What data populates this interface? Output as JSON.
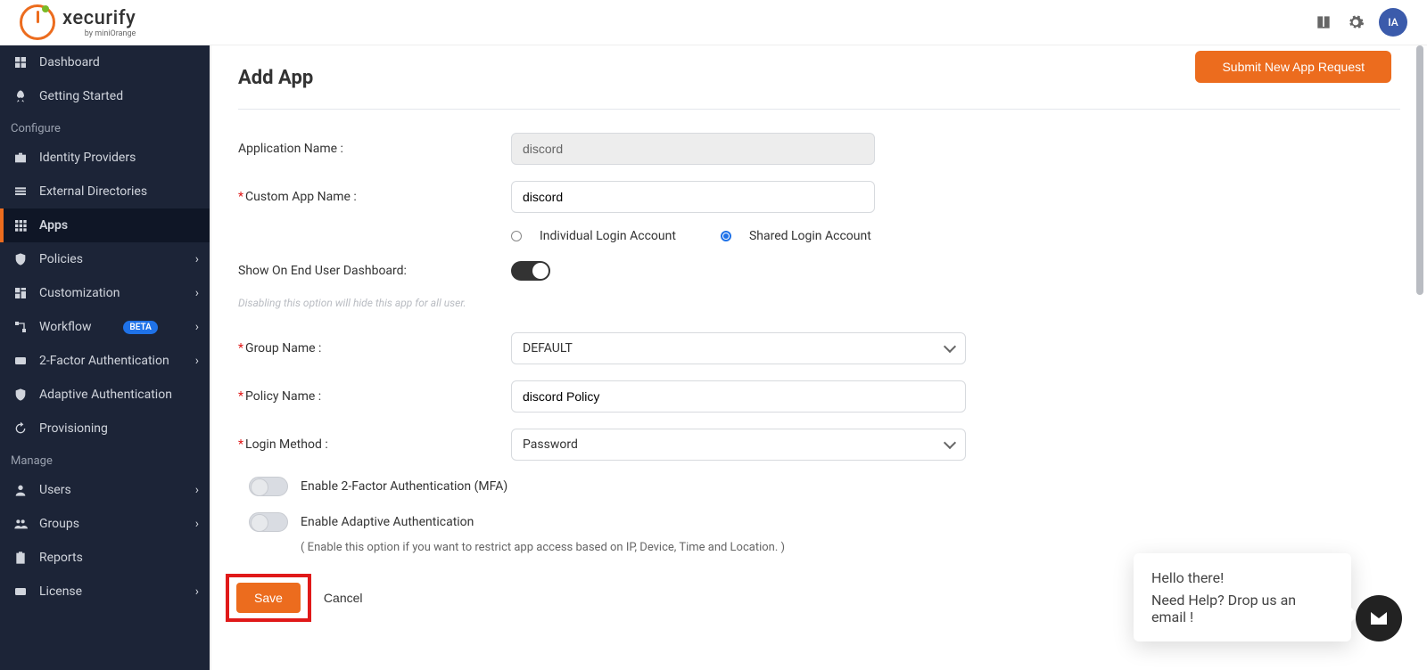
{
  "header": {
    "brand": "xecurify",
    "sub_brand": "by miniOrange",
    "avatar_initials": "IA"
  },
  "sidebar": {
    "sections": {
      "configure": "Configure",
      "manage": "Manage"
    },
    "items": {
      "dashboard": "Dashboard",
      "getting_started": "Getting Started",
      "identity_providers": "Identity Providers",
      "external_directories": "External Directories",
      "apps": "Apps",
      "policies": "Policies",
      "customization": "Customization",
      "workflow": "Workflow",
      "workflow_badge": "BETA",
      "two_factor": "2-Factor Authentication",
      "adaptive_auth": "Adaptive Authentication",
      "provisioning": "Provisioning",
      "users": "Users",
      "groups": "Groups",
      "reports": "Reports",
      "license": "License"
    }
  },
  "main": {
    "top_button": "Submit New App Request",
    "title": "Add App",
    "labels": {
      "app_name": "Application Name :",
      "custom_app_name": "Custom App Name :",
      "individual_login": "Individual Login Account",
      "shared_login": "Shared Login Account",
      "show_dashboard": "Show On End User Dashboard:",
      "disable_hint": "Disabling this option will hide this app for all user.",
      "group_name": "Group Name :",
      "policy_name": "Policy Name :",
      "login_method": "Login Method :",
      "enable_2fa": "Enable 2-Factor Authentication (MFA)",
      "enable_adaptive": "Enable Adaptive Authentication",
      "adaptive_hint": "( Enable this option if you want to restrict app access based on IP, Device, Time and Location. )"
    },
    "values": {
      "app_name": "discord",
      "custom_app_name": "discord",
      "group_name": "DEFAULT",
      "policy_name": "discord Policy",
      "login_method": "Password"
    },
    "buttons": {
      "save": "Save",
      "cancel": "Cancel"
    }
  },
  "chat": {
    "line1": "Hello there!",
    "line2": "Need Help? Drop us an email !"
  }
}
